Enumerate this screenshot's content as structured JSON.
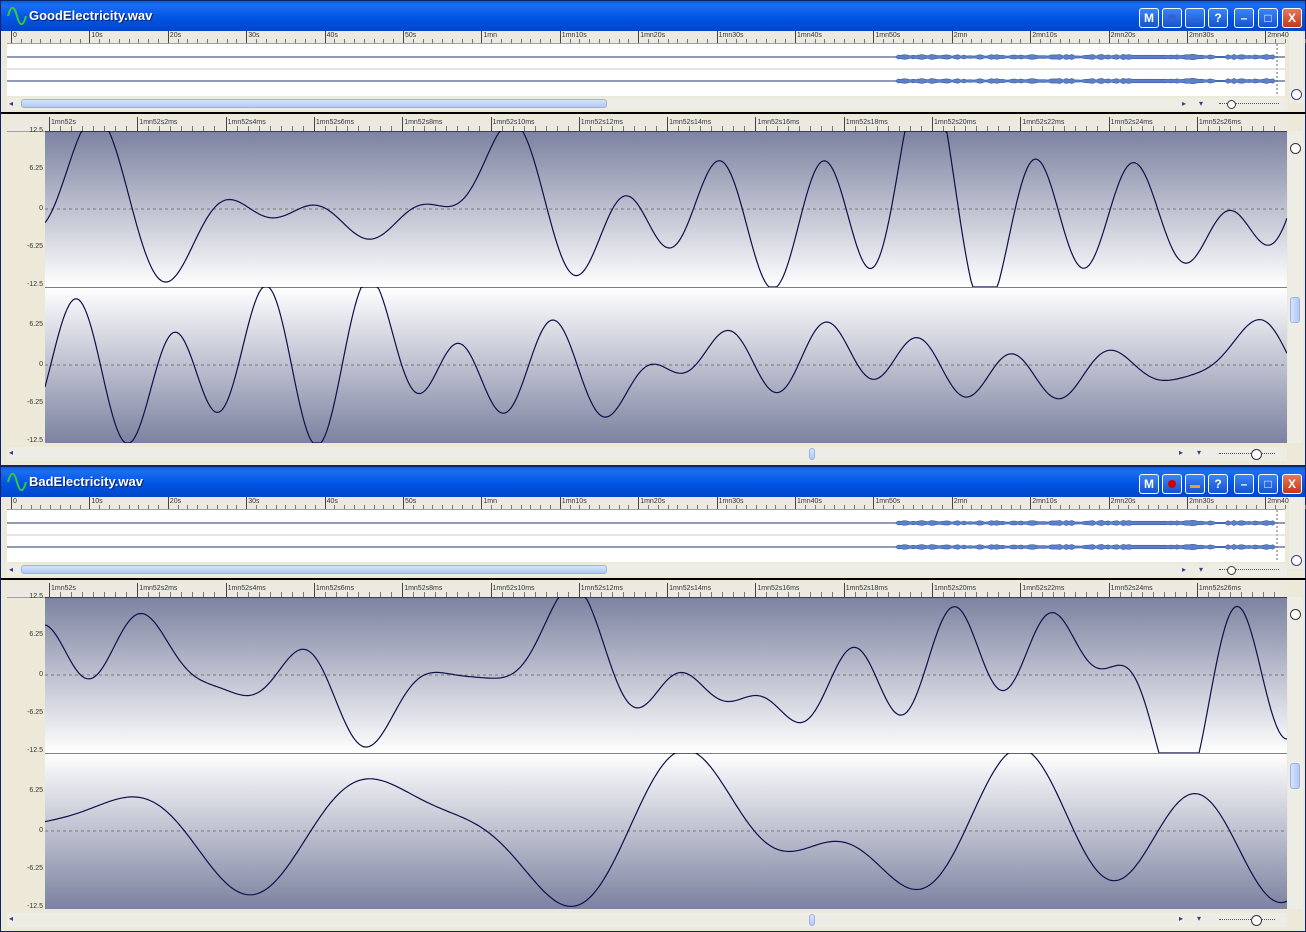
{
  "windows": [
    {
      "title": "GoodElectricity.wav",
      "buttons": {
        "m": "M",
        "help": "?",
        "minimize": "–",
        "maximize": "□",
        "close": "X"
      },
      "record_active": false
    },
    {
      "title": "BadElectricity.wav",
      "buttons": {
        "m": "M",
        "help": "?",
        "minimize": "–",
        "maximize": "□",
        "close": "X"
      },
      "record_active": true
    }
  ],
  "overview_ruler": [
    "0",
    "10s",
    "20s",
    "30s",
    "40s",
    "50s",
    "1mn",
    "1mn10s",
    "1mn20s",
    "1mn30s",
    "1mn40s",
    "1mn50s",
    "2mn",
    "2mn10s",
    "2mn20s",
    "2mn30s",
    "2mn40s"
  ],
  "detail_ruler": [
    "1mn52s",
    "1mn52s2ms",
    "1mn52s4ms",
    "1mn52s6ms",
    "1mn52s8ms",
    "1mn52s10ms",
    "1mn52s12ms",
    "1mn52s14ms",
    "1mn52s16ms",
    "1mn52s18ms",
    "1mn52s20ms",
    "1mn52s22ms",
    "1mn52s24ms",
    "1mn52s26ms"
  ],
  "amplitude_labels": [
    "12.5",
    "6.25",
    "0",
    "-6.25",
    "-12.5"
  ],
  "colors": {
    "title_bar": "#0055e5",
    "waveform": "#10104a",
    "overview_wave": "#5b7fc9",
    "record_dot": "#d40000"
  }
}
